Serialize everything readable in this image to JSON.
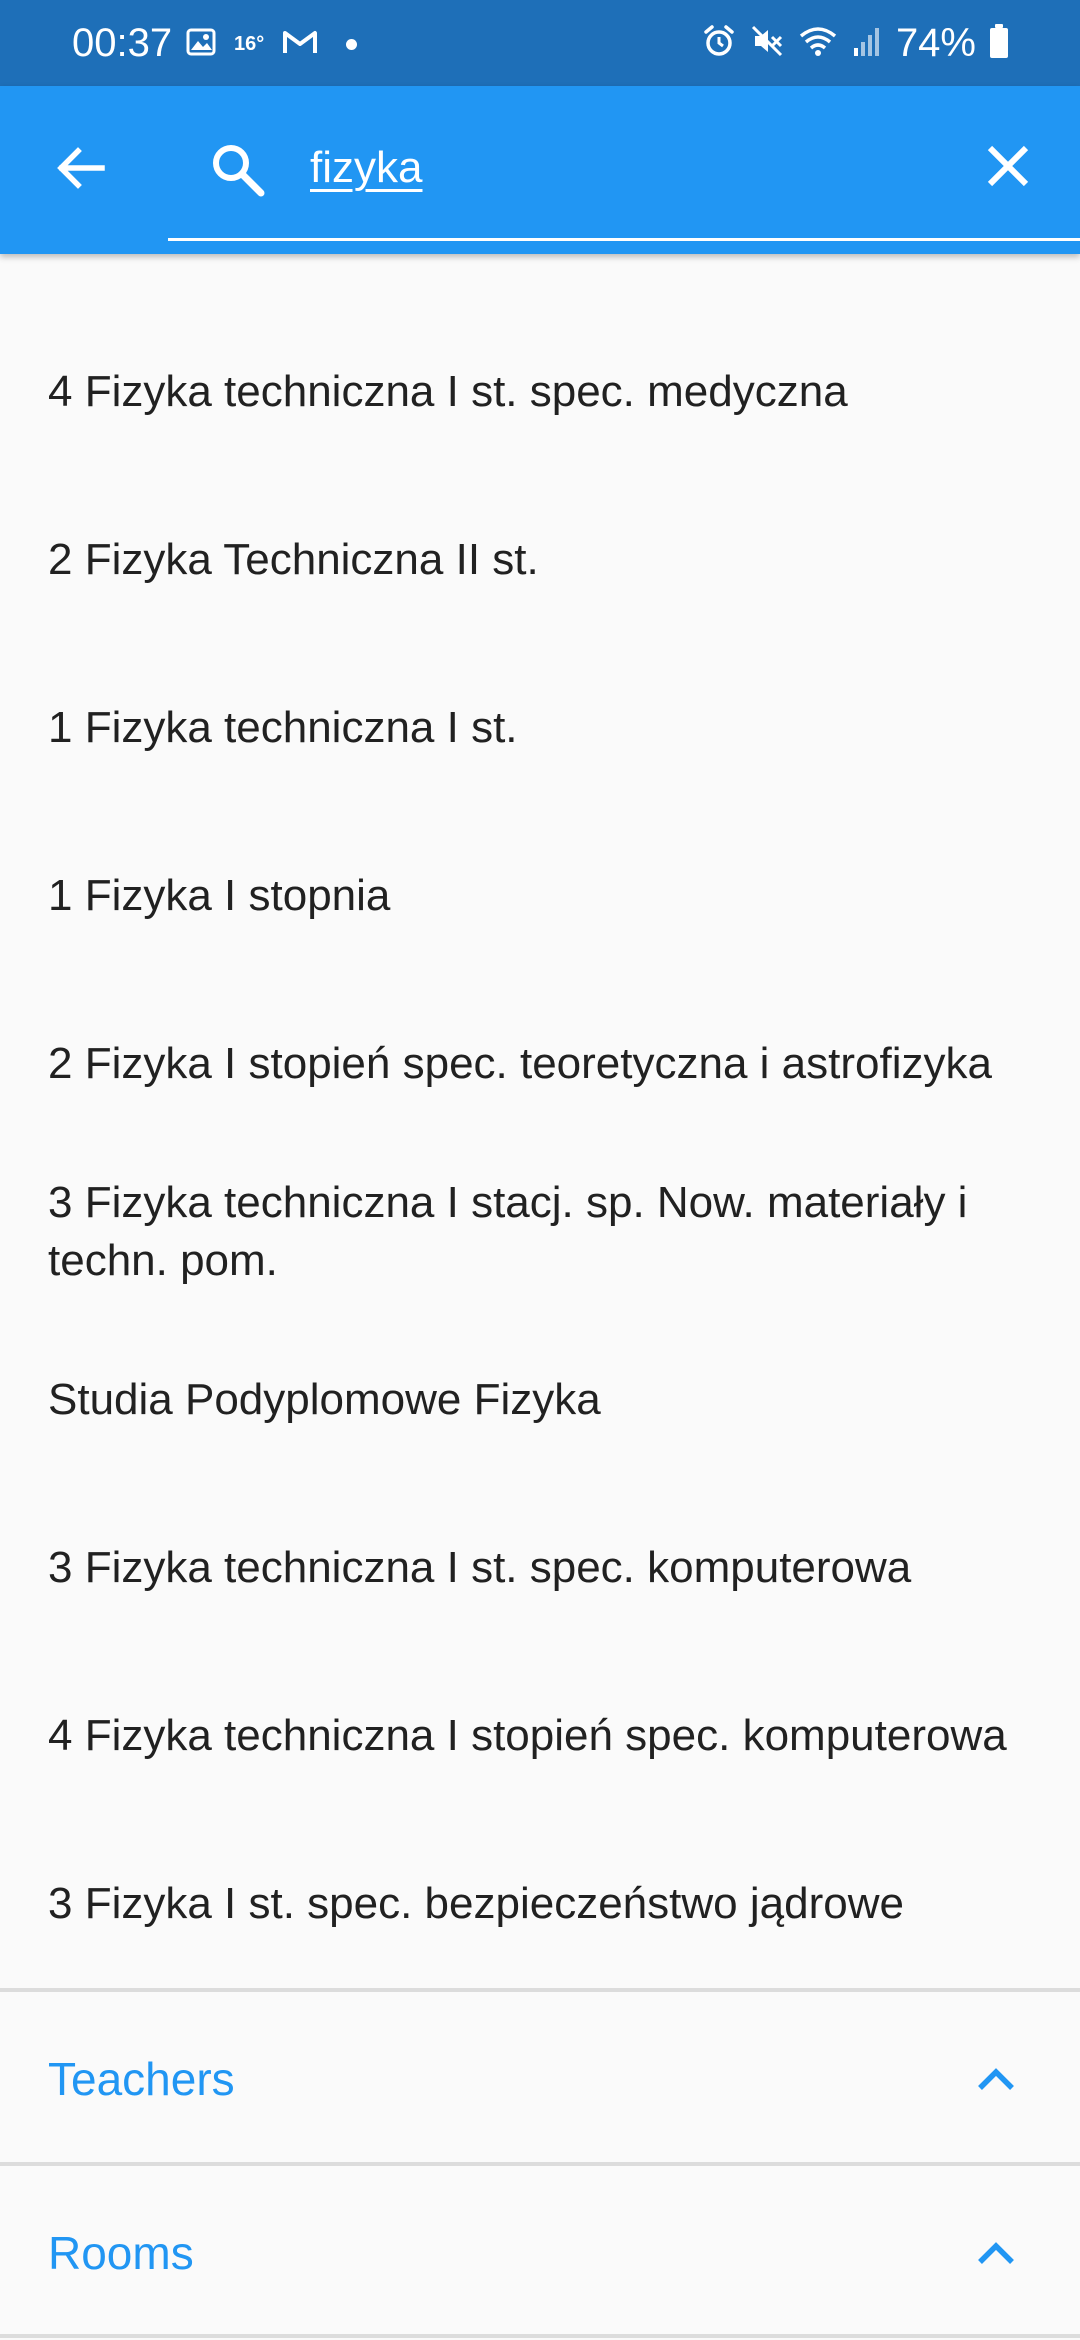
{
  "status_bar": {
    "time": "00:37",
    "temp_label": "16°",
    "battery": "74%",
    "icons": [
      "image-icon",
      "weather-icon",
      "gmail-icon",
      "notification-dot-icon",
      "alarm-icon",
      "mute-icon",
      "wifi-icon",
      "signal-icon",
      "battery-icon"
    ]
  },
  "search": {
    "query": "fizyka",
    "icons": [
      "back-arrow-icon",
      "search-icon",
      "close-icon"
    ]
  },
  "results": [
    "4 Fizyka techniczna I st. spec. medyczna",
    "2 Fizyka Techniczna II st.",
    "1 Fizyka techniczna I st.",
    "1 Fizyka I stopnia",
    "2 Fizyka I stopień spec. teoretyczna i astrofizyka",
    "3 Fizyka techniczna I stacj. sp. Now. materiały i techn. pom.",
    "Studia Podyplomowe Fizyka",
    "3 Fizyka techniczna I st. spec.  komputerowa",
    "4 Fizyka techniczna I stopień spec. komputerowa",
    "3 Fizyka I st. spec.  bezpieczeństwo jądrowe"
  ],
  "sections": [
    {
      "title": "Teachers",
      "icon": "chevron-up-icon"
    },
    {
      "title": "Rooms",
      "icon": "chevron-up-icon"
    }
  ],
  "colors": {
    "status_bar": "#1e6fb8",
    "app_bar": "#2196f3",
    "accent": "#2196f3",
    "text": "#212121",
    "background": "#fafafa"
  }
}
